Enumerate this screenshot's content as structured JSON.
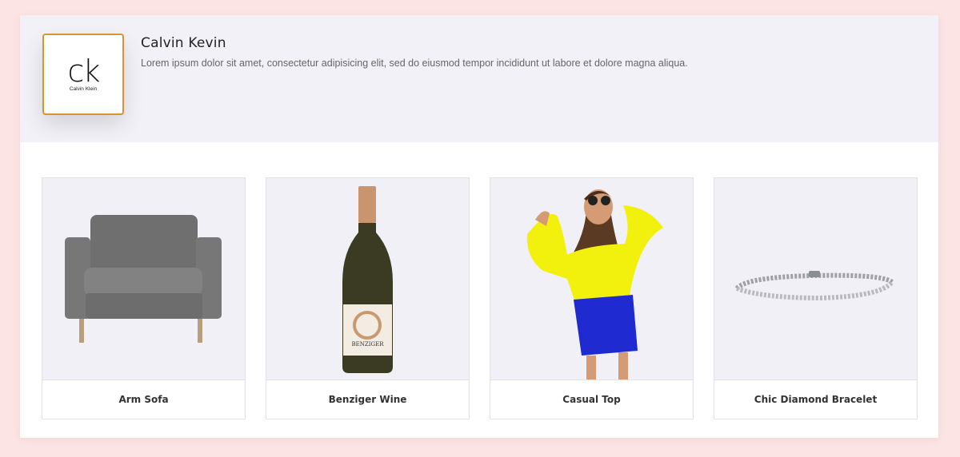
{
  "brand": {
    "logo_mark": "ck",
    "logo_text": "Calvin Klein",
    "name": "Calvin Kevin",
    "description": "Lorem ipsum dolor sit amet, consectetur adipisicing elit, sed do eiusmod tempor incididunt ut labore et dolore magna aliqua."
  },
  "wine_label": {
    "name": "BENZIGER"
  },
  "products": [
    {
      "name": "Arm Sofa",
      "image": "sofa"
    },
    {
      "name": "Benziger Wine",
      "image": "wine-bottle"
    },
    {
      "name": "Casual Top",
      "image": "model-yellow-top"
    },
    {
      "name": "Chic Diamond Bracelet",
      "image": "bracelet"
    }
  ],
  "colors": {
    "background": "#fde4e4",
    "header_bg": "#f2f1f7",
    "logo_border": "#d9942d",
    "image_bg": "#f1f0f7"
  }
}
